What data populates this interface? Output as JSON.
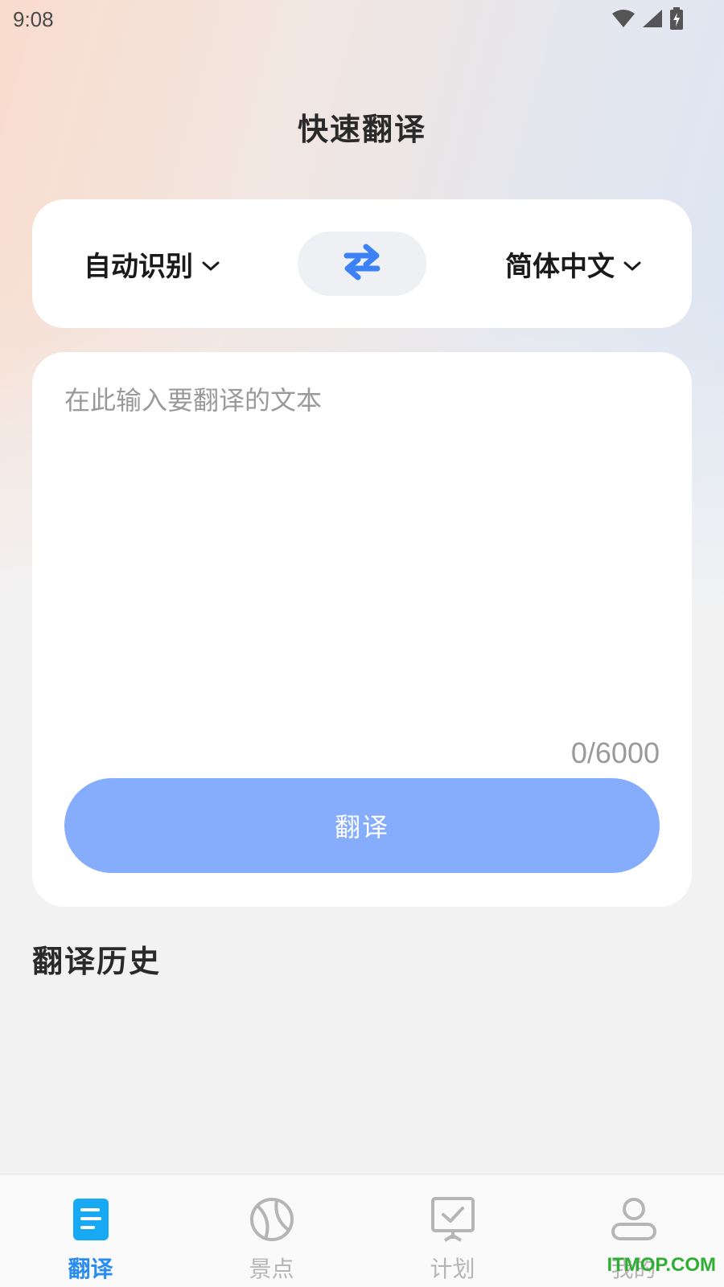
{
  "status_bar": {
    "time": "9:08",
    "icons": [
      "wifi-icon",
      "signal-icon",
      "battery-charging-icon"
    ]
  },
  "header": {
    "title": "快速翻译"
  },
  "language": {
    "source": "自动识别",
    "target": "简体中文",
    "swap_icon": "swap-arrows-icon"
  },
  "input": {
    "placeholder": "在此输入要翻译的文本",
    "value": "",
    "char_count": "0/6000"
  },
  "actions": {
    "translate_label": "翻译"
  },
  "history": {
    "title": "翻译历史"
  },
  "nav": {
    "items": [
      {
        "label": "翻译",
        "icon": "document-icon",
        "active": true
      },
      {
        "label": "景点",
        "icon": "ball-icon",
        "active": false
      },
      {
        "label": "计划",
        "icon": "checklist-board-icon",
        "active": false
      },
      {
        "label": "我的",
        "icon": "user-icon",
        "active": false
      }
    ]
  },
  "watermark": "ITMOP.COM",
  "colors": {
    "accent": "#2a8cf0",
    "button_disabled": "#86adfb",
    "swap_icon": "#3d82f5",
    "inactive": "#b5b5b5"
  }
}
